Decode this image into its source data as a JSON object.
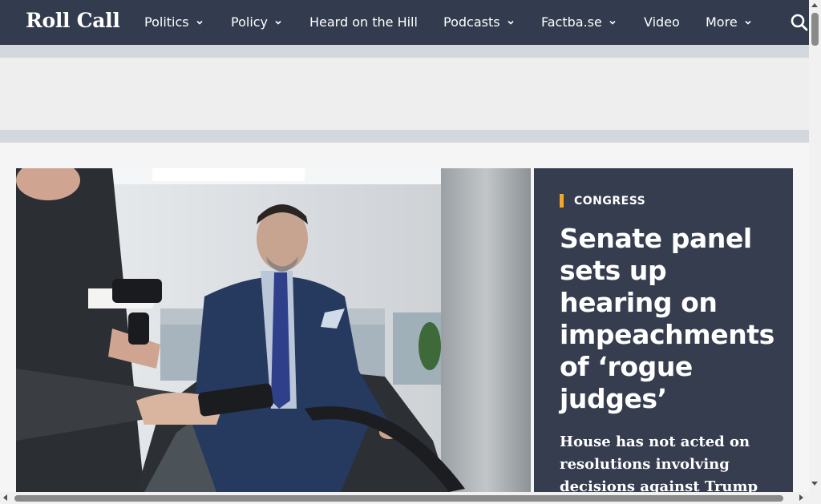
{
  "site": {
    "logo": "Roll Call"
  },
  "nav": {
    "items": [
      {
        "label": "Politics",
        "dropdown": true
      },
      {
        "label": "Policy",
        "dropdown": true
      },
      {
        "label": "Heard on the Hill",
        "dropdown": false
      },
      {
        "label": "Podcasts",
        "dropdown": true
      },
      {
        "label": "Factba.se",
        "dropdown": true
      },
      {
        "label": "Video",
        "dropdown": false
      },
      {
        "label": "More",
        "dropdown": true
      }
    ],
    "search_icon": "search-icon"
  },
  "hero": {
    "kicker": "CONGRESS",
    "headline": "Senate panel sets up hearing on impeachments of ‘rogue judges’",
    "dek": "House has not acted on resolutions involving decisions against Trump"
  },
  "colors": {
    "nav_bg": "#323c4e",
    "card_bg": "#353d4f",
    "kicker_accent": "#f5a623",
    "ad_band": "#d3d7de"
  }
}
